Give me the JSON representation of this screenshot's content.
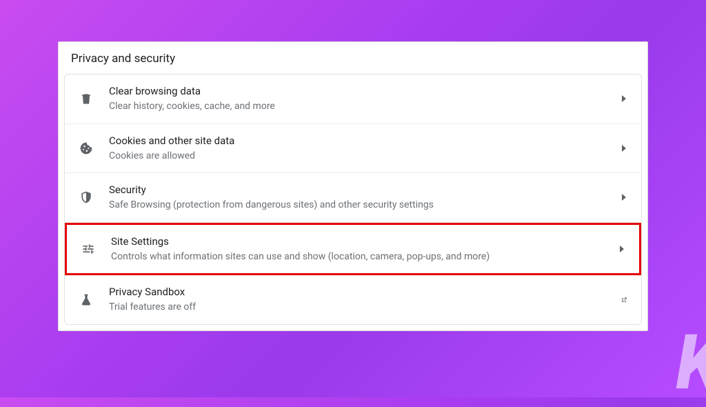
{
  "header": {
    "title": "Privacy and security"
  },
  "rows": [
    {
      "icon": "trash-icon",
      "title": "Clear browsing data",
      "sub": "Clear history, cookies, cache, and more",
      "trailing": "chevron"
    },
    {
      "icon": "cookie-icon",
      "title": "Cookies and other site data",
      "sub": "Cookies are allowed",
      "trailing": "chevron"
    },
    {
      "icon": "shield-icon",
      "title": "Security",
      "sub": "Safe Browsing (protection from dangerous sites) and other security settings",
      "trailing": "chevron"
    },
    {
      "icon": "sliders-icon",
      "title": "Site Settings",
      "sub": "Controls what information sites can use and show (location, camera, pop-ups, and more)",
      "trailing": "chevron",
      "highlight": true
    },
    {
      "icon": "flask-icon",
      "title": "Privacy Sandbox",
      "sub": "Trial features are off",
      "trailing": "external"
    }
  ],
  "watermark": "K"
}
